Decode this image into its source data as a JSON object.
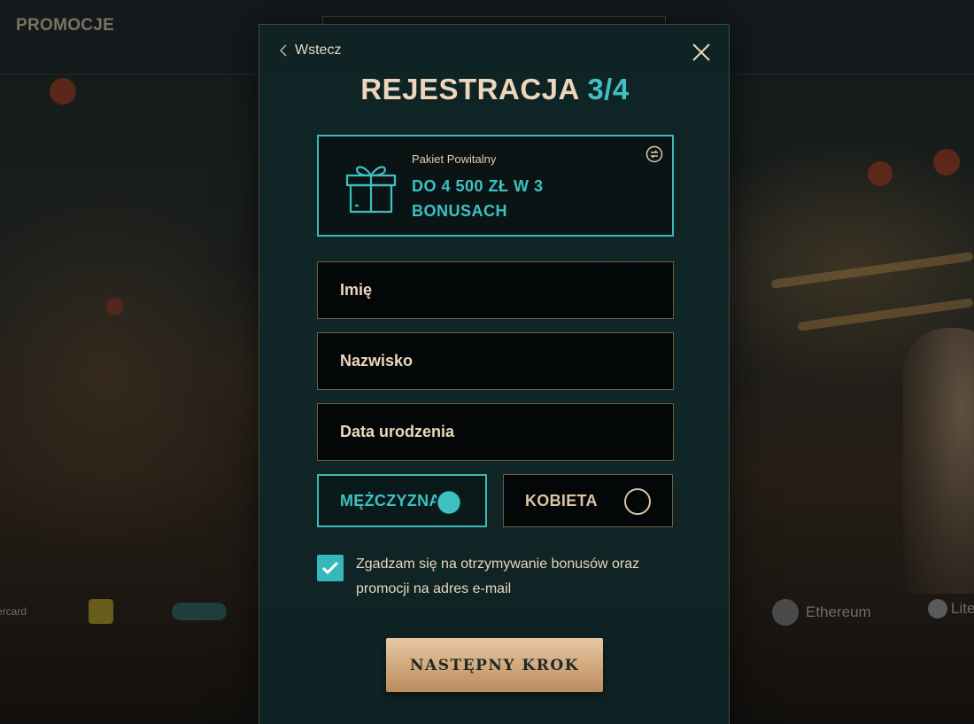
{
  "background": {
    "nav_label": "PROMOCJE",
    "payments": [
      "ercard",
      "Ethereum",
      "Lite"
    ]
  },
  "modal": {
    "back_label": "Wstecz",
    "title_main": "REJESTRACJA",
    "title_step": "3/4",
    "bonus": {
      "subtitle": "Pakiet Powitalny",
      "headline": "DO 4 500 ZŁ W 3 BONUSACH"
    },
    "fields": {
      "first_name_placeholder": "Imię",
      "last_name_placeholder": "Nazwisko",
      "birthdate_placeholder": "Data urodzenia"
    },
    "gender": {
      "male_label": "MĘŻCZYZNA",
      "female_label": "KOBIETA",
      "selected": "male"
    },
    "consent": {
      "checked": true,
      "text": "Zgadzam się na otrzymywanie bonusów oraz promocji na adres e-mail"
    },
    "next_button_label": "NASTĘPNY KROK"
  },
  "colors": {
    "accent_teal": "#3fc0c2",
    "text_gold": "#ecd7bd",
    "button_gold": "#d2aa7e"
  }
}
